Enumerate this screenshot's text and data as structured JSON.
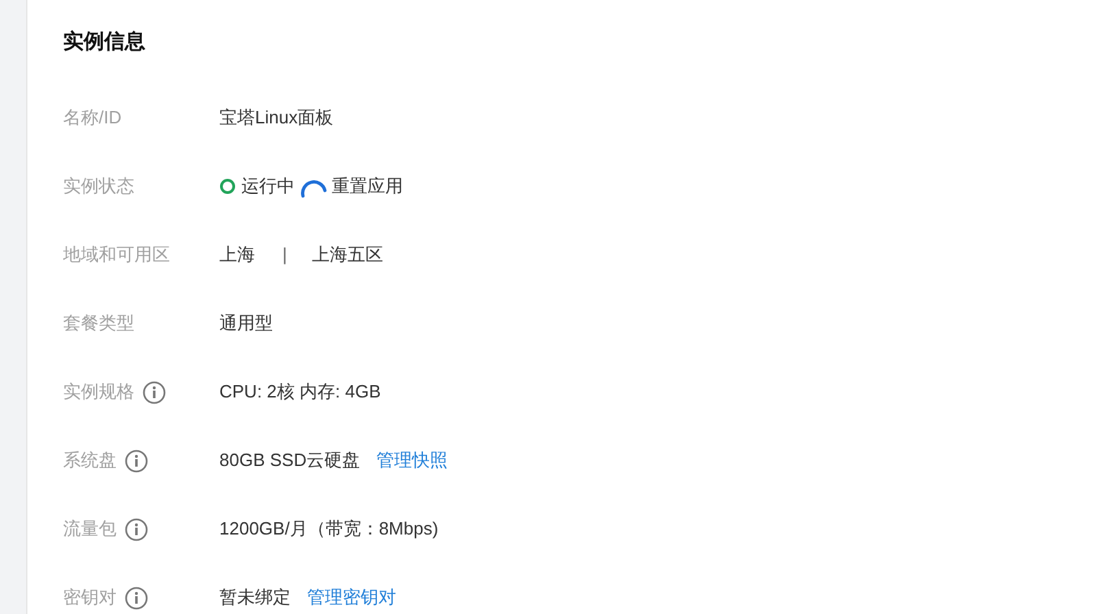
{
  "title": "实例信息",
  "rows": [
    {
      "label": "名称/ID",
      "info": false,
      "value": [
        {
          "kind": "text",
          "text": "宝塔Linux面板"
        }
      ]
    },
    {
      "label": "实例状态",
      "info": false,
      "value": [
        {
          "kind": "status",
          "text": "运行中"
        },
        {
          "kind": "loading",
          "text": "重置应用"
        }
      ]
    },
    {
      "label": "地域和可用区",
      "info": false,
      "value": [
        {
          "kind": "text",
          "text": "上海"
        },
        {
          "kind": "separator",
          "text": "|"
        },
        {
          "kind": "text",
          "text": "上海五区"
        }
      ]
    },
    {
      "label": "套餐类型",
      "info": false,
      "value": [
        {
          "kind": "text",
          "text": "通用型"
        }
      ]
    },
    {
      "label": "实例规格",
      "info": true,
      "value": [
        {
          "kind": "text",
          "text": "CPU: 2核 内存: 4GB"
        }
      ]
    },
    {
      "label": "系统盘",
      "info": true,
      "value": [
        {
          "kind": "text",
          "text": "80GB SSD云硬盘"
        },
        {
          "kind": "link",
          "text": "管理快照"
        }
      ]
    },
    {
      "label": "流量包",
      "info": true,
      "value": [
        {
          "kind": "text",
          "text": "1200GB/月（带宽：8Mbps)"
        }
      ]
    },
    {
      "label": "密钥对",
      "info": true,
      "value": [
        {
          "kind": "text",
          "text": "暂未绑定"
        },
        {
          "kind": "link",
          "text": "管理密钥对"
        }
      ]
    }
  ]
}
